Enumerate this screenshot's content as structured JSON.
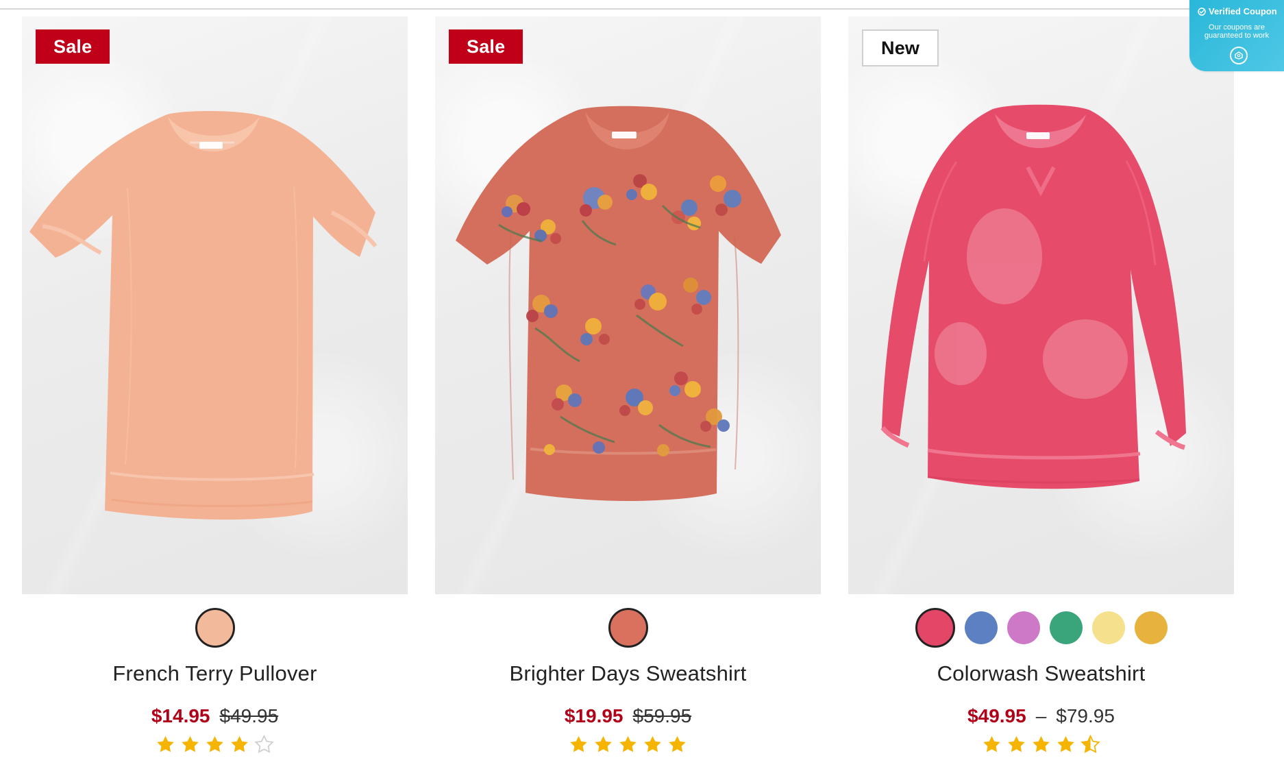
{
  "coupon": {
    "title": "Verified Coupon",
    "subtitle_line1": "Our coupons are",
    "subtitle_line2": "guaranteed to work"
  },
  "products": [
    {
      "badge": "Sale",
      "name": "French Terry Pullover",
      "sale_price": "$14.95",
      "regular_price": "$49.95",
      "rating": 4,
      "swatches": [
        "#f2b99b"
      ],
      "selected_swatch": 0
    },
    {
      "badge": "Sale",
      "name": "Brighter Days Sweatshirt",
      "sale_price": "$19.95",
      "regular_price": "$59.95",
      "rating": 5,
      "swatches": [
        "#d9715e"
      ],
      "selected_swatch": 0
    },
    {
      "badge": "New",
      "name": "Colorwash Sweatshirt",
      "sale_price": "$49.95",
      "range_separator": "–",
      "max_price": "$79.95",
      "rating": 4.5,
      "swatches": [
        "#e44667",
        "#5c80c2",
        "#cd79c8",
        "#3aa57b",
        "#f4e08d",
        "#e7b23d"
      ],
      "selected_swatch": 0
    }
  ],
  "colors": {
    "sale_red": "#c00018",
    "star": "#f5b400",
    "coupon_blue": "#29b7d9"
  }
}
